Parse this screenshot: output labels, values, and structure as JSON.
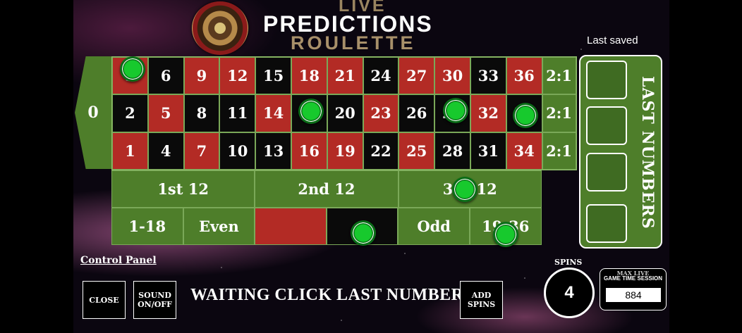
{
  "header": {
    "live": "LIVE",
    "predictions": "PREDICTIONS",
    "roulette": "ROULETTE"
  },
  "board": {
    "zero": "0",
    "rows": [
      [
        {
          "n": "3",
          "c": "red"
        },
        {
          "n": "6",
          "c": "blk"
        },
        {
          "n": "9",
          "c": "red"
        },
        {
          "n": "12",
          "c": "red"
        },
        {
          "n": "15",
          "c": "blk"
        },
        {
          "n": "18",
          "c": "red"
        },
        {
          "n": "21",
          "c": "red"
        },
        {
          "n": "24",
          "c": "blk"
        },
        {
          "n": "27",
          "c": "red"
        },
        {
          "n": "30",
          "c": "red"
        },
        {
          "n": "33",
          "c": "blk"
        },
        {
          "n": "36",
          "c": "red"
        },
        {
          "n": "2:1",
          "c": "grn"
        }
      ],
      [
        {
          "n": "2",
          "c": "blk"
        },
        {
          "n": "5",
          "c": "red"
        },
        {
          "n": "8",
          "c": "blk"
        },
        {
          "n": "11",
          "c": "blk"
        },
        {
          "n": "14",
          "c": "red"
        },
        {
          "n": "17",
          "c": "blk"
        },
        {
          "n": "20",
          "c": "blk"
        },
        {
          "n": "23",
          "c": "red"
        },
        {
          "n": "26",
          "c": "blk"
        },
        {
          "n": "29",
          "c": "blk"
        },
        {
          "n": "32",
          "c": "red"
        },
        {
          "n": "35",
          "c": "blk"
        },
        {
          "n": "2:1",
          "c": "grn"
        }
      ],
      [
        {
          "n": "1",
          "c": "red"
        },
        {
          "n": "4",
          "c": "blk"
        },
        {
          "n": "7",
          "c": "red"
        },
        {
          "n": "10",
          "c": "blk"
        },
        {
          "n": "13",
          "c": "blk"
        },
        {
          "n": "16",
          "c": "red"
        },
        {
          "n": "19",
          "c": "red"
        },
        {
          "n": "22",
          "c": "blk"
        },
        {
          "n": "25",
          "c": "red"
        },
        {
          "n": "28",
          "c": "blk"
        },
        {
          "n": "31",
          "c": "blk"
        },
        {
          "n": "34",
          "c": "red"
        },
        {
          "n": "2:1",
          "c": "grn"
        }
      ]
    ],
    "dozens": [
      "1st 12",
      "2nd 12",
      "3rd 12"
    ],
    "outside": [
      {
        "label": "1-18",
        "c": "grn"
      },
      {
        "label": "Even",
        "c": "grn"
      },
      {
        "label": "",
        "c": "red"
      },
      {
        "label": "",
        "c": "blk"
      },
      {
        "label": "Odd",
        "c": "grn"
      },
      {
        "label": "19-36",
        "c": "grn"
      }
    ],
    "chips_on": [
      "3",
      "17",
      "29",
      "35",
      "3rd 12",
      "black",
      "19-36"
    ]
  },
  "last_numbers": {
    "saved_label": "Last saved",
    "title": "LAST NUMBERS",
    "slots": [
      "",
      "",
      "",
      ""
    ]
  },
  "control_panel": {
    "label": "Control Panel",
    "close": "CLOSE",
    "sound": "SOUND ON/OFF",
    "status": "WAITING CLICK LAST NUMBER",
    "add_spins": "ADD SPINS",
    "spins_label": "SPINS",
    "spins_value": "4",
    "session_title1": "MAX LIVE",
    "session_title2": "GAME TIME SESSION",
    "session_value": "884"
  },
  "colors": {
    "felt": "#4e7e2a",
    "red": "#b32b25",
    "black": "#0a0a0a",
    "chip": "#17c92d"
  }
}
